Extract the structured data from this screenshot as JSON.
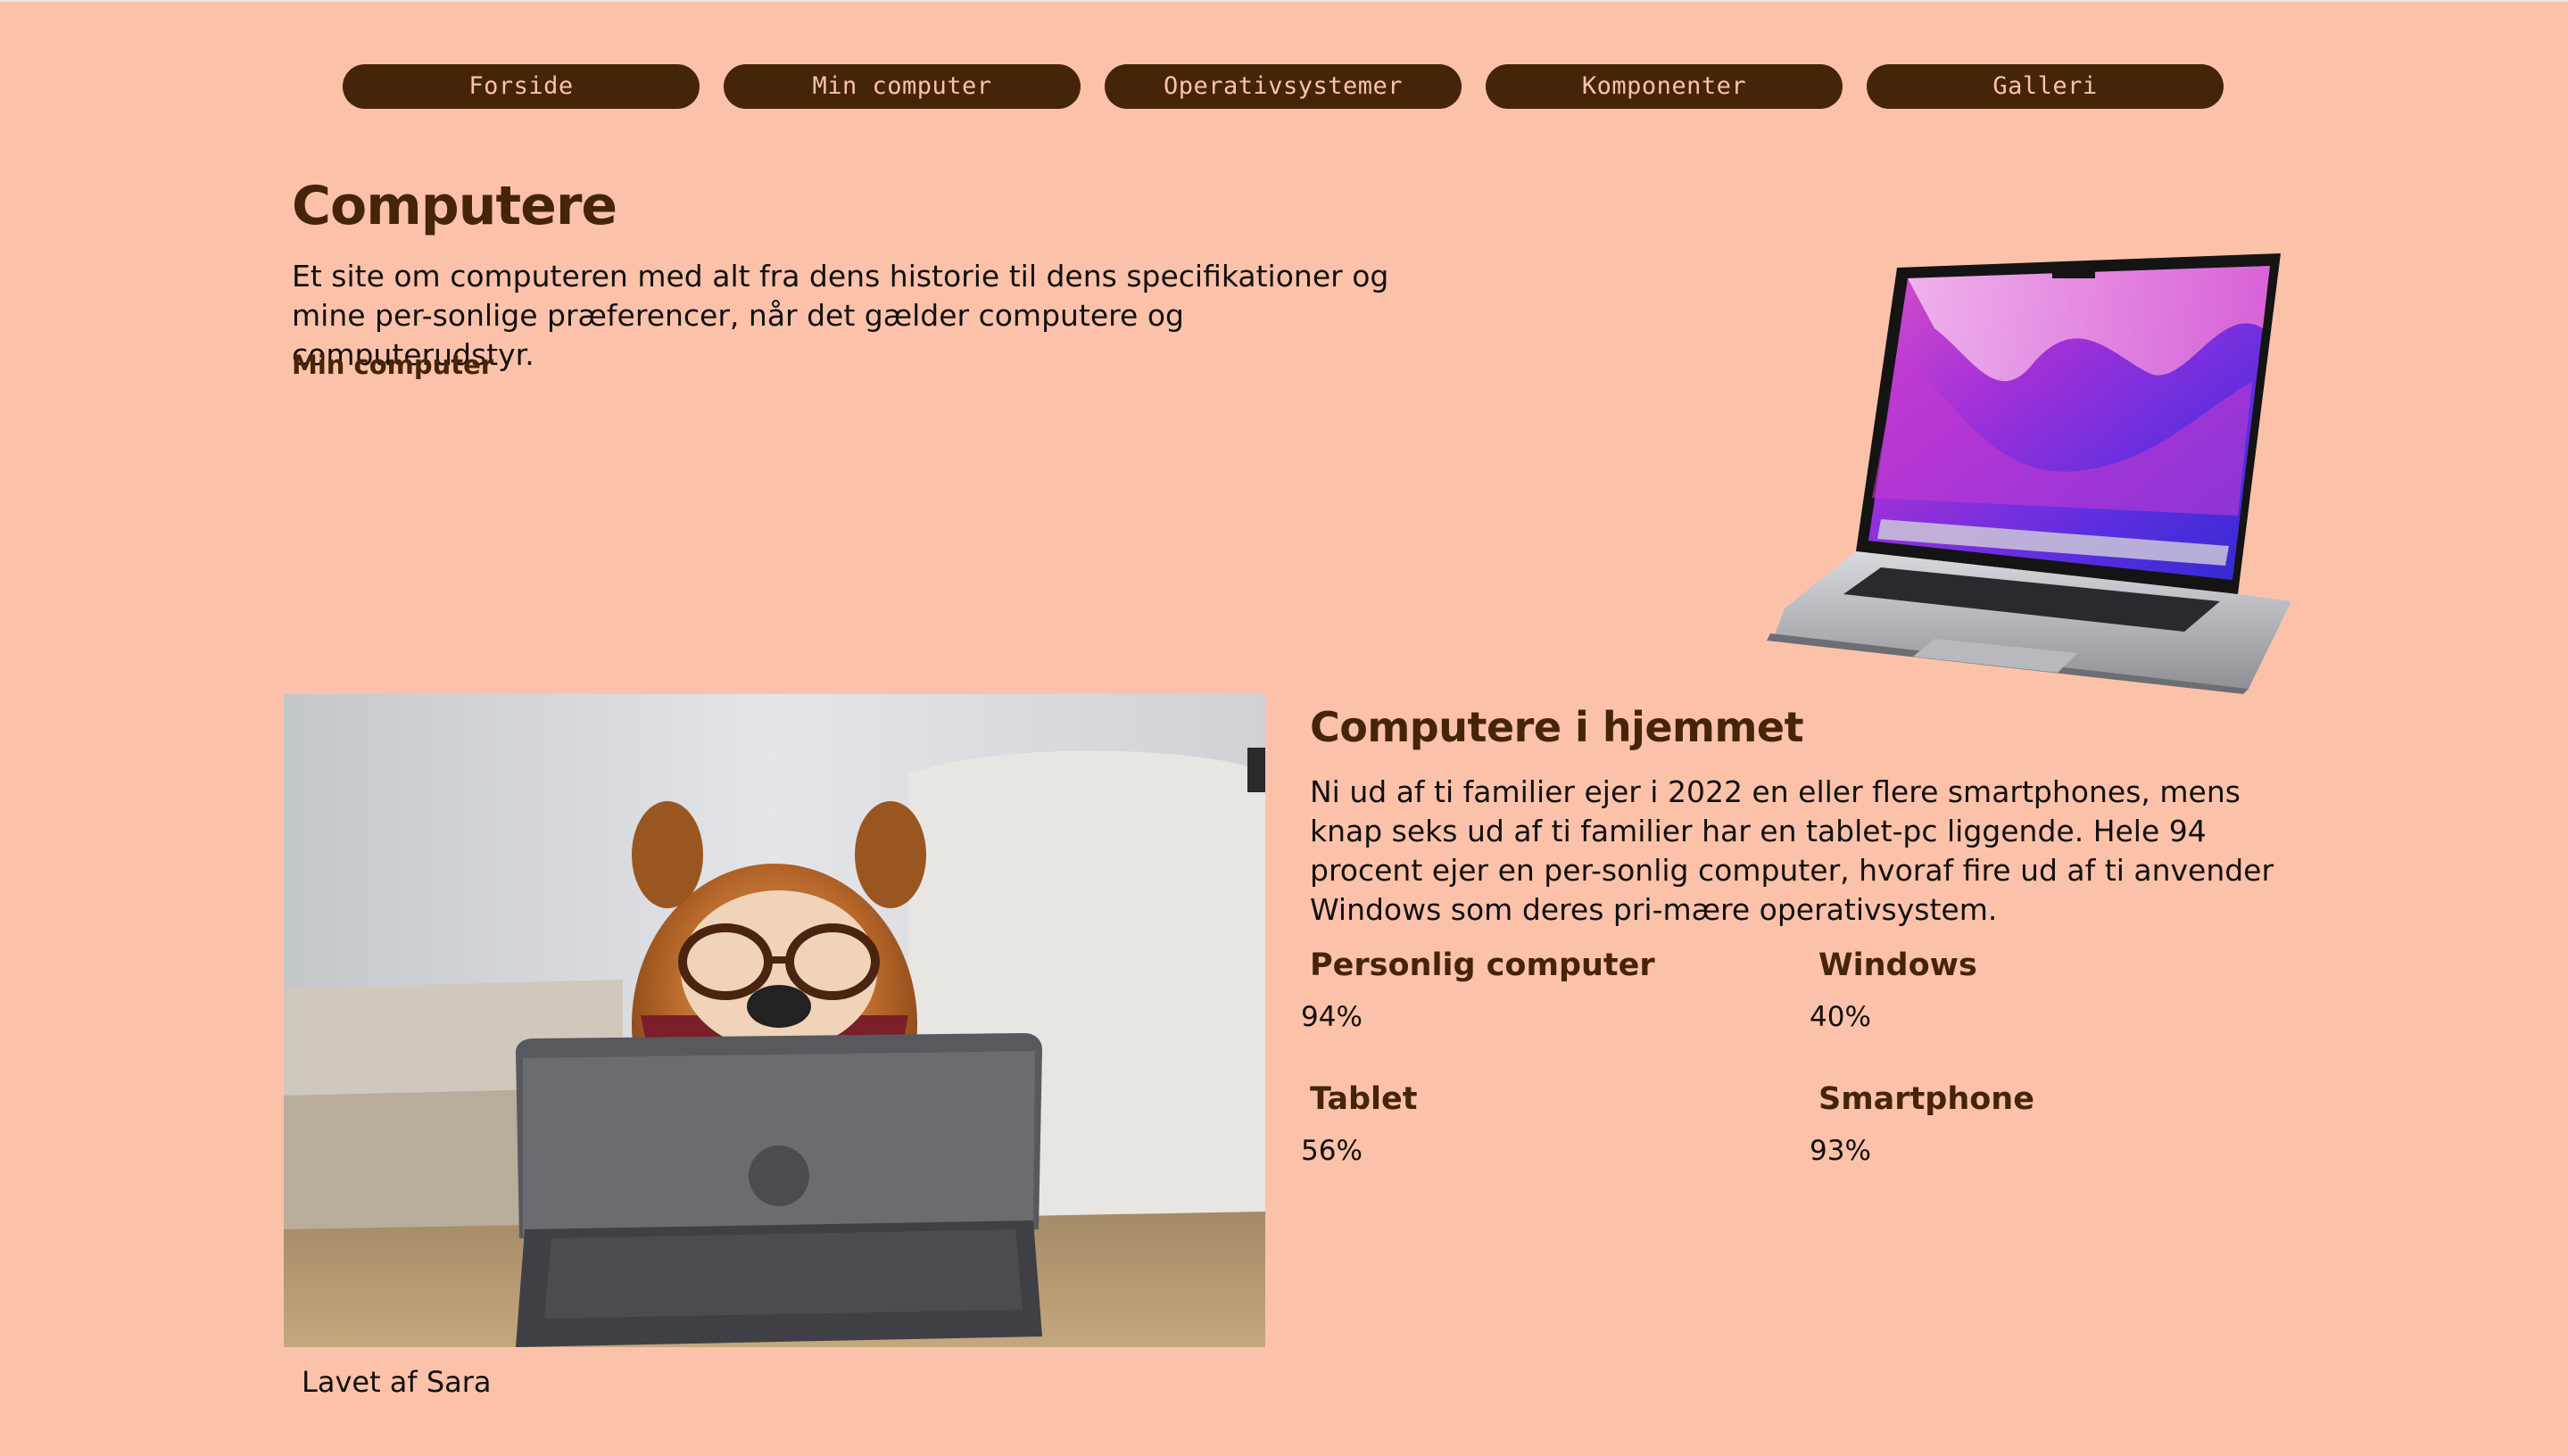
{
  "nav": {
    "items": [
      {
        "label": "Forside"
      },
      {
        "label": "Min computer"
      },
      {
        "label": "Operativsystemer"
      },
      {
        "label": "Komponenter"
      },
      {
        "label": "Galleri"
      }
    ]
  },
  "hero": {
    "title": "Computere",
    "text": "Et site om computeren med alt fra dens historie til dens specifikationer og mine per-sonlige præferencer, når det gælder computere og computerudstyr.",
    "link": "Min computer"
  },
  "section": {
    "title": "Computere i hjemmet",
    "text": "Ni ud af ti familier ejer i 2022 en eller flere smartphones, mens knap seks ud af ti familier har en tablet-pc liggende. Hele 94 procent ejer en per-sonlig computer, hvoraf fire ud af ti anvender Windows som deres pri-mære operativsystem.",
    "stats": [
      {
        "label": "Personlig computer",
        "value": "94%"
      },
      {
        "label": "Windows",
        "value": "40%"
      },
      {
        "label": "Tablet",
        "value": "56%"
      },
      {
        "label": "Smartphone",
        "value": "93%"
      }
    ]
  },
  "footer": {
    "text": "Lavet af Sara"
  },
  "colors": {
    "background": "#fcc2a9",
    "brown": "#45250a"
  }
}
